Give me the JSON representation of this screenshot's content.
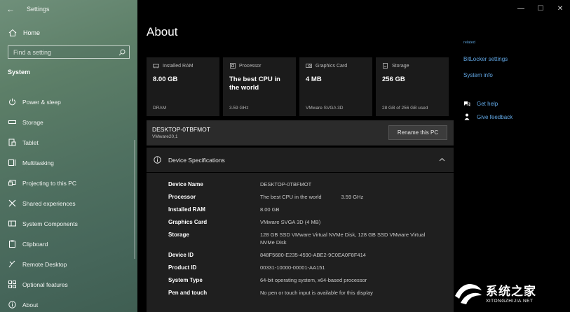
{
  "window": {
    "app_title": "Settings",
    "controls": {
      "minimize": "—",
      "maximize": "☐",
      "close": "✕"
    }
  },
  "sidebar": {
    "home_label": "Home",
    "search_placeholder": "Find a setting",
    "section_label": "System",
    "items": [
      {
        "label": "Power & sleep",
        "icon": "power-icon"
      },
      {
        "label": "Storage",
        "icon": "storage-icon"
      },
      {
        "label": "Tablet",
        "icon": "tablet-icon"
      },
      {
        "label": "Multitasking",
        "icon": "multitasking-icon"
      },
      {
        "label": "Projecting to this PC",
        "icon": "projecting-icon"
      },
      {
        "label": "Shared experiences",
        "icon": "shared-experiences-icon"
      },
      {
        "label": "System Components",
        "icon": "system-components-icon"
      },
      {
        "label": "Clipboard",
        "icon": "clipboard-icon"
      },
      {
        "label": "Remote Desktop",
        "icon": "remote-desktop-icon"
      },
      {
        "label": "Optional features",
        "icon": "optional-features-icon"
      },
      {
        "label": "About",
        "icon": "info-icon"
      }
    ]
  },
  "main": {
    "title": "About",
    "cards": [
      {
        "label": "Installed RAM",
        "value": "8.00 GB",
        "sub": "DRAM"
      },
      {
        "label": "Processor",
        "value": "The best CPU in the world",
        "sub": "3.59 GHz"
      },
      {
        "label": "Graphics Card",
        "value": "4 MB",
        "sub": "VMware SVGA 3D"
      },
      {
        "label": "Storage",
        "value": "256 GB",
        "sub": "28 GB of 256 GB used"
      }
    ],
    "device": {
      "name": "DESKTOP-0TBFMOT",
      "version": "VMware20,1",
      "rename_label": "Rename this PC"
    },
    "specs": {
      "title": "Device Specifications",
      "rows": [
        {
          "key": "Device Name",
          "value": "DESKTOP-0TBFMOT",
          "extra": ""
        },
        {
          "key": "Processor",
          "value": "The best CPU in the world",
          "extra": "3.59 GHz"
        },
        {
          "key": "Installed RAM",
          "value": "8.00 GB",
          "extra": ""
        },
        {
          "key": "Graphics Card",
          "value": "VMware SVGA 3D (4 MB)",
          "extra": ""
        },
        {
          "key": "Storage",
          "value": "128 GB SSD VMware Virtual NVMe Disk, 128 GB SSD VMware Virtual NVMe Disk",
          "extra": ""
        },
        {
          "key": "Device ID",
          "value": "848F5680-E235-4590-ABE2-9C0EA0F8F414",
          "extra": ""
        },
        {
          "key": "Product ID",
          "value": "00331-10000-00001-AA151",
          "extra": ""
        },
        {
          "key": "System Type",
          "value": "64-bit operating system, x64-based processor",
          "extra": ""
        },
        {
          "key": "Pen and touch",
          "value": "No pen or touch input is available for this display",
          "extra": ""
        }
      ]
    }
  },
  "right": {
    "related_label": "related",
    "links": [
      "BitLocker settings",
      "System info"
    ],
    "help": [
      {
        "label": "Get help",
        "icon": "get-help-icon"
      },
      {
        "label": "Give feedback",
        "icon": "feedback-icon"
      }
    ]
  },
  "watermark": {
    "cn": "系统之家",
    "en": "XITONGZHIJIA.NET"
  },
  "colors": {
    "accent_link": "#62a8e6",
    "card_bg": "#1b1b1b",
    "panel_bg": "#1f1f1f"
  }
}
